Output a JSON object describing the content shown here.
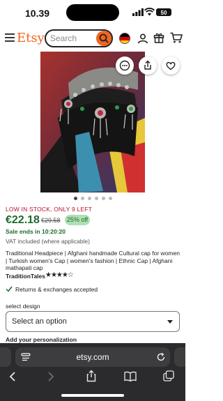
{
  "status_bar": {
    "time": "10.39",
    "battery": "50"
  },
  "header": {
    "logo": "Etsy",
    "search_placeholder": "Search"
  },
  "product": {
    "stock_notice": "LOW IN STOCK, ONLY 9 LEFT",
    "price": "€22.18",
    "original_price": "€29.58",
    "discount_badge": "25% off",
    "sale_ends": "Sale ends in 10:20:20",
    "vat_note": "VAT included (where applicable)",
    "title": "Traditional Headpiece | Afghani handmade Cultural cap for women | Turkish women's Cap | women's fashion | Ethnic Cap | Afghani mathapati cap",
    "shop_name": "TraditionTales",
    "rating_stars": "★★★★☆",
    "rating_value": 4,
    "returns_text": "Returns & exchanges accepted",
    "image_count": 6,
    "active_image": 1
  },
  "options": {
    "select_design_label": "select design",
    "select_design_value": "Select an option",
    "personalization_label": "Add your personalization"
  },
  "browser": {
    "url": "etsy.com"
  },
  "colors": {
    "etsy_orange": "#f1641e",
    "sale_green": "#1e6b2d",
    "stock_red": "#b3132b",
    "safari_dark": "#2b2b2e"
  },
  "icons": [
    "menu-icon",
    "search-icon",
    "flag-icon",
    "user-icon",
    "gift-icon",
    "cart-icon",
    "more-icon",
    "share-icon",
    "heart-icon",
    "check-icon",
    "back-icon",
    "forward-icon",
    "share-icon",
    "bookmarks-icon",
    "tabs-icon",
    "reload-icon",
    "reader-icon"
  ]
}
